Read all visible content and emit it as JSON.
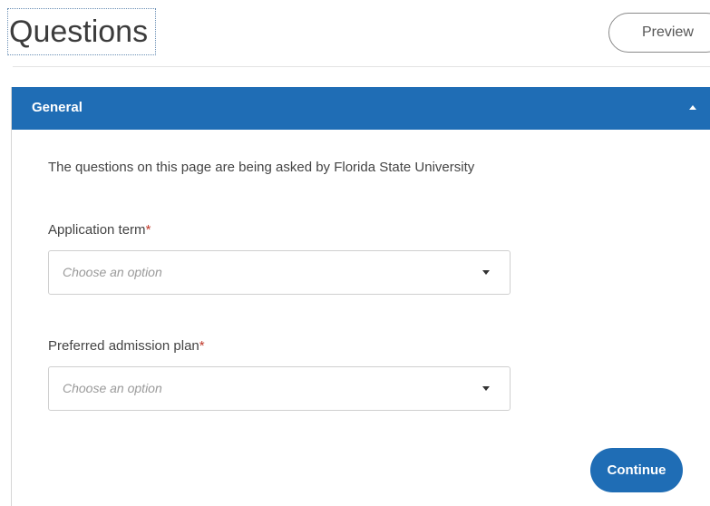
{
  "header": {
    "title": "Questions",
    "preview_label": "Preview"
  },
  "section": {
    "title": "General",
    "collapse_icon": "chevron-up-icon",
    "intro": "The questions on this page are being asked by Florida State University",
    "fields": [
      {
        "label": "Application term",
        "required_mark": "*",
        "placeholder": "Choose an option",
        "icon": "caret-down-icon"
      },
      {
        "label": "Preferred admission plan",
        "required_mark": "*",
        "placeholder": "Choose an option",
        "icon": "caret-down-icon"
      }
    ],
    "continue_label": "Continue"
  },
  "colors": {
    "accent": "#1f6db5",
    "required": "#c0392b",
    "placeholder": "#9a9a9a"
  }
}
